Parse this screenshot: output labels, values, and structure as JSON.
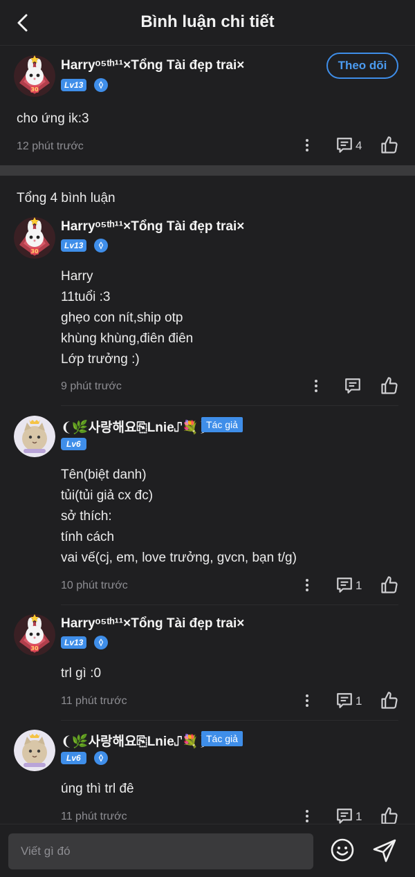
{
  "header": {
    "title": "Bình luận chi tiết"
  },
  "post": {
    "author": "Harryᵒ⁵ᵗʰ¹¹×Tổng Tài đẹp trai×",
    "level": "Lv13",
    "follow_label": "Theo dõi",
    "content": "cho ứng ik:3",
    "time": "12 phút trước",
    "reply_count": "4"
  },
  "comments_title": "Tổng 4 bình luận",
  "comments": [
    {
      "author": "Harryᵒ⁵ᵗʰ¹¹×Tổng Tài đẹp trai×",
      "level": "Lv13",
      "lines": [
        "Harry",
        "11tuổi :3",
        "ghẹo con nít,ship otp",
        "khùng khùng,điên điên",
        "Lớp trưởng :)"
      ],
      "time": "9 phút trước",
      "reply_count": ""
    },
    {
      "author": "❨🌿사랑해요⎘Lnie⑀💐❩",
      "level": "Lv6",
      "author_tag": "Tác giả",
      "lines": [
        "Tên(biệt danh)",
        "tủi(tủi giả cx đc)",
        "sở thích:",
        "tính cách",
        "vai vế(cj, em, love trưởng, gvcn, bạn t/g)"
      ],
      "time": "10 phút trước",
      "reply_count": "1"
    },
    {
      "author": "Harryᵒ⁵ᵗʰ¹¹×Tổng Tài đẹp trai×",
      "level": "Lv13",
      "lines": [
        "trl gì :0"
      ],
      "time": "11 phút trước",
      "reply_count": "1"
    },
    {
      "author": "❨🌿사랑해요⎘Lnie⑀💐❩",
      "level": "Lv6",
      "author_tag": "Tác giả",
      "lines": [
        "úng thì trl đê"
      ],
      "time": "11 phút trước",
      "reply_count": "1"
    }
  ],
  "input": {
    "placeholder": "Viết gì đó"
  },
  "colors": {
    "accent": "#3f8ee9",
    "background": "#1f1f21",
    "muted": "#8e8e93"
  },
  "icons": [
    "back-icon",
    "more-icon",
    "reply-icon",
    "like-icon",
    "emoji-icon",
    "send-icon",
    "verified-icon"
  ]
}
